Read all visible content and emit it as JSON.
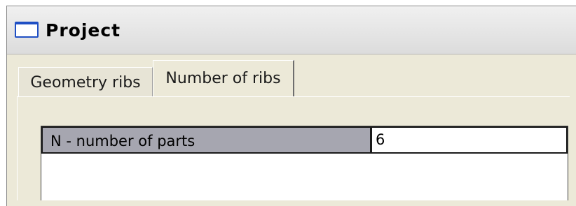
{
  "window": {
    "title": "Project"
  },
  "tabs": [
    {
      "label": "Geometry ribs",
      "active": false
    },
    {
      "label": "Number of ribs",
      "active": true
    }
  ],
  "grid": {
    "rows": [
      {
        "label": "N - number of parts",
        "value": "6"
      }
    ]
  },
  "colors": {
    "title_icon": "#1f4fc4",
    "label_cell_bg": "#a6a6b0",
    "window_bg": "#ece9d8"
  }
}
